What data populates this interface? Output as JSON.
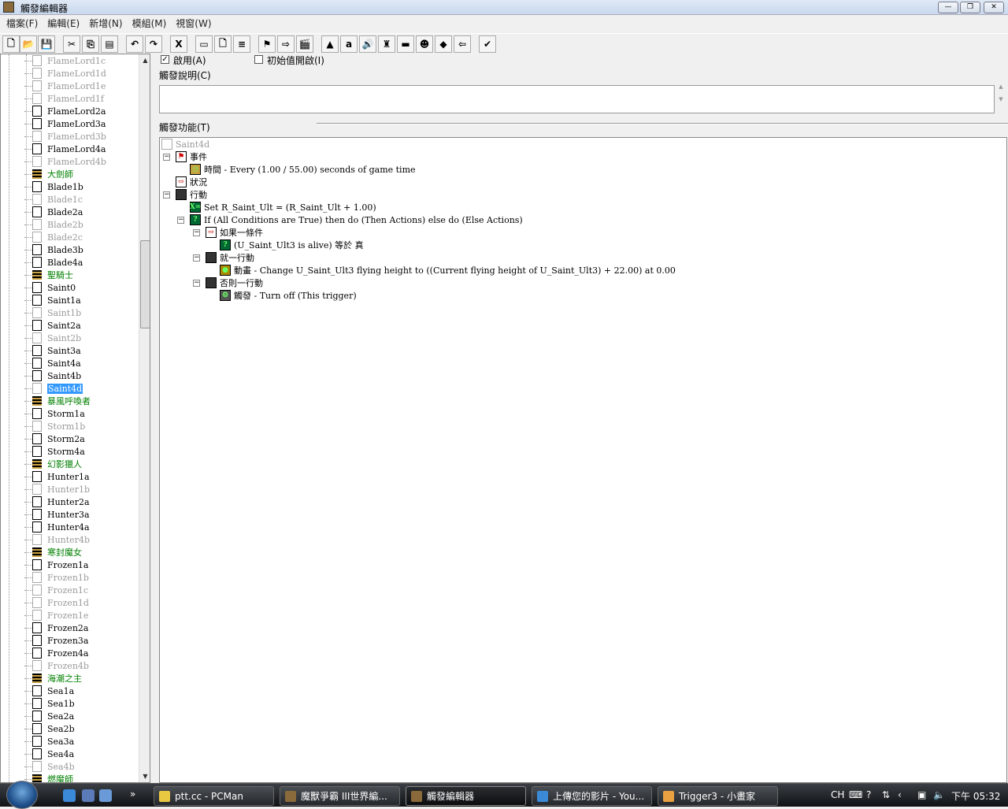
{
  "window": {
    "title": "觸發編輯器",
    "min": "—",
    "max": "❐",
    "close": "✕"
  },
  "menu": [
    "檔案(F)",
    "編輯(E)",
    "新增(N)",
    "模組(M)",
    "視窗(W)"
  ],
  "toolbar": [
    {
      "name": "new-icon",
      "g": "🗋"
    },
    {
      "name": "open-icon",
      "g": "📂"
    },
    {
      "name": "save-icon",
      "g": "💾"
    },
    {
      "name": "cut-icon",
      "g": "✂"
    },
    {
      "name": "copy-icon",
      "g": "⎘"
    },
    {
      "name": "paste-icon",
      "g": "▤"
    },
    {
      "name": "undo-icon",
      "g": "↶"
    },
    {
      "name": "redo-icon",
      "g": "↷"
    },
    {
      "name": "variables-icon",
      "g": "X"
    },
    {
      "name": "new-category-icon",
      "g": "▭"
    },
    {
      "name": "new-trigger-icon",
      "g": "🗋"
    },
    {
      "name": "new-comment-icon",
      "g": "≡"
    },
    {
      "name": "new-event-icon",
      "g": "⚑"
    },
    {
      "name": "new-condition-icon",
      "g": "⇨"
    },
    {
      "name": "new-action-icon",
      "g": "🎬"
    },
    {
      "name": "terrain-editor-icon",
      "g": "▲"
    },
    {
      "name": "trigger-editor-icon",
      "g": "a"
    },
    {
      "name": "sound-editor-icon",
      "g": "🔊"
    },
    {
      "name": "object-editor-icon",
      "g": "♜"
    },
    {
      "name": "campaign-editor-icon",
      "g": "▬"
    },
    {
      "name": "ai-editor-icon",
      "g": "☻"
    },
    {
      "name": "object-manager-icon",
      "g": "◆"
    },
    {
      "name": "import-manager-icon",
      "g": "⇦"
    },
    {
      "name": "test-map-icon",
      "g": "✔"
    }
  ],
  "tree": {
    "items": [
      {
        "label": "FlameLord1c",
        "s": "dis"
      },
      {
        "label": "FlameLord1d",
        "s": "dis"
      },
      {
        "label": "FlameLord1e",
        "s": "dis"
      },
      {
        "label": "FlameLord1f",
        "s": "dis"
      },
      {
        "label": "FlameLord2a",
        "s": "on"
      },
      {
        "label": "FlameLord3a",
        "s": "on"
      },
      {
        "label": "FlameLord3b",
        "s": "dis"
      },
      {
        "label": "FlameLord4a",
        "s": "on"
      },
      {
        "label": "FlameLord4b",
        "s": "dis"
      },
      {
        "label": "大劍師",
        "s": "cat"
      },
      {
        "label": "Blade1b",
        "s": "on"
      },
      {
        "label": "Blade1c",
        "s": "dis"
      },
      {
        "label": "Blade2a",
        "s": "on"
      },
      {
        "label": "Blade2b",
        "s": "dis"
      },
      {
        "label": "Blade2c",
        "s": "dis"
      },
      {
        "label": "Blade3b",
        "s": "on"
      },
      {
        "label": "Blade4a",
        "s": "on"
      },
      {
        "label": "聖騎士",
        "s": "cat"
      },
      {
        "label": "Saint0",
        "s": "on"
      },
      {
        "label": "Saint1a",
        "s": "on"
      },
      {
        "label": "Saint1b",
        "s": "dis"
      },
      {
        "label": "Saint2a",
        "s": "on"
      },
      {
        "label": "Saint2b",
        "s": "dis"
      },
      {
        "label": "Saint3a",
        "s": "on"
      },
      {
        "label": "Saint4a",
        "s": "on"
      },
      {
        "label": "Saint4b",
        "s": "on"
      },
      {
        "label": "Saint4d",
        "s": "dis sel"
      },
      {
        "label": "暴風呼喚者",
        "s": "cat"
      },
      {
        "label": "Storm1a",
        "s": "on"
      },
      {
        "label": "Storm1b",
        "s": "dis"
      },
      {
        "label": "Storm2a",
        "s": "on"
      },
      {
        "label": "Storm4a",
        "s": "on"
      },
      {
        "label": "幻影獵人",
        "s": "cat"
      },
      {
        "label": "Hunter1a",
        "s": "on"
      },
      {
        "label": "Hunter1b",
        "s": "dis"
      },
      {
        "label": "Hunter2a",
        "s": "on"
      },
      {
        "label": "Hunter3a",
        "s": "on"
      },
      {
        "label": "Hunter4a",
        "s": "on"
      },
      {
        "label": "Hunter4b",
        "s": "dis"
      },
      {
        "label": "寒封魔女",
        "s": "cat"
      },
      {
        "label": "Frozen1a",
        "s": "on"
      },
      {
        "label": "Frozen1b",
        "s": "dis"
      },
      {
        "label": "Frozen1c",
        "s": "dis"
      },
      {
        "label": "Frozen1d",
        "s": "dis"
      },
      {
        "label": "Frozen1e",
        "s": "dis"
      },
      {
        "label": "Frozen2a",
        "s": "on"
      },
      {
        "label": "Frozen3a",
        "s": "on"
      },
      {
        "label": "Frozen4a",
        "s": "on"
      },
      {
        "label": "Frozen4b",
        "s": "dis"
      },
      {
        "label": "海潮之主",
        "s": "cat"
      },
      {
        "label": "Sea1a",
        "s": "on"
      },
      {
        "label": "Sea1b",
        "s": "on"
      },
      {
        "label": "Sea2a",
        "s": "on"
      },
      {
        "label": "Sea2b",
        "s": "on"
      },
      {
        "label": "Sea3a",
        "s": "on"
      },
      {
        "label": "Sea4a",
        "s": "on"
      },
      {
        "label": "Sea4b",
        "s": "dis"
      },
      {
        "label": "燃魔師",
        "s": "cat"
      }
    ]
  },
  "trigger": {
    "enabled_label": "啟用(A)",
    "enabled": true,
    "initially_on_label": "初始值開啟(I)",
    "initially_on": false,
    "comment_label": "觸發說明(C)",
    "comment": "",
    "functions_label": "觸發功能(T)",
    "nodes": [
      {
        "t": "Saint4d",
        "lvl": 0,
        "icon": "trigger-icon",
        "c": "#fff",
        "g": "",
        "gray": true
      },
      {
        "t": "事件",
        "lvl": 0,
        "icon": "event-flag-icon",
        "c": "#fff",
        "g": "⚑",
        "exp": true
      },
      {
        "t": "時間 - Every (1.00 / 55.00) seconds of game time",
        "lvl": 1,
        "icon": "timer-icon",
        "c": "#c9a040",
        "g": "◷"
      },
      {
        "t": "狀況",
        "lvl": 0,
        "icon": "condition-icon",
        "c": "#fff",
        "g": "⇨"
      },
      {
        "t": "行動",
        "lvl": 0,
        "icon": "action-icon",
        "c": "#333",
        "g": "",
        "exp": true
      },
      {
        "t": "Set R_Saint_Ult = (R_Saint_Ult + 1.00)",
        "lvl": 1,
        "icon": "set-variable-icon",
        "c": "#063",
        "g": "X="
      },
      {
        "t": "If (All Conditions are True) then do (Then Actions) else do (Else Actions)",
        "lvl": 1,
        "icon": "if-then-else-icon",
        "c": "#063",
        "g": "?",
        "exp": true
      },
      {
        "t": "如果一條件",
        "lvl": 2,
        "icon": "condition-icon",
        "c": "#fff",
        "g": "⇨",
        "exp": true
      },
      {
        "t": "(U_Saint_Ult3 is alive) 等於 真",
        "lvl": 3,
        "icon": "boolean-condition-icon",
        "c": "#063",
        "g": "?"
      },
      {
        "t": "就一行動",
        "lvl": 2,
        "icon": "action-icon",
        "c": "#333",
        "g": "",
        "exp": true
      },
      {
        "t": "動畫 - Change U_Saint_Ult3 flying height to ((Current flying height of U_Saint_Ult3) + 22.00) at 0.00",
        "lvl": 3,
        "icon": "animation-icon",
        "c": "#a80",
        "g": "●"
      },
      {
        "t": "否則一行動",
        "lvl": 2,
        "icon": "action-icon",
        "c": "#333",
        "g": "",
        "exp": true
      },
      {
        "t": "觸發 - Turn off (This trigger)",
        "lvl": 3,
        "icon": "trigger-gear-icon",
        "c": "#555",
        "g": "⚙"
      }
    ]
  },
  "taskbar": {
    "items": [
      {
        "label": "ptt.cc - PCMan",
        "c": "#e8c840"
      },
      {
        "label": "魔獸爭霸 III世界編...",
        "c": "#8a6a3a"
      },
      {
        "label": "觸發編輯器",
        "c": "#8a6a3a",
        "active": true
      },
      {
        "label": "上傳您的影片 - You...",
        "c": "#3a8ad8"
      },
      {
        "label": "Trigger3 - 小畫家",
        "c": "#e8a040"
      }
    ],
    "lang": "CH",
    "time": "下午 05:32",
    "chevron": "»"
  }
}
